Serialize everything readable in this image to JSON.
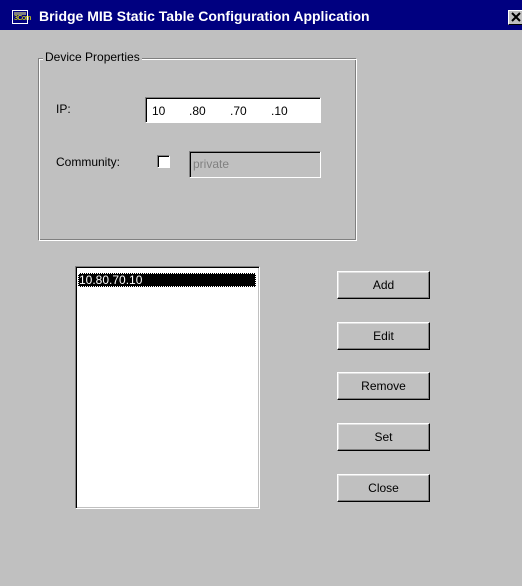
{
  "window": {
    "title": "Bridge MIB Static Table Configuration Application",
    "icon_label": "3Com",
    "icon": "app-icon",
    "close_icon": "close-icon"
  },
  "device_properties": {
    "group_label": "Device Properties",
    "ip_label": "IP:",
    "ip_octets": [
      "10",
      ".80",
      ".70",
      ".10"
    ],
    "community_label": "Community:",
    "community_checked": false,
    "community_value": "private"
  },
  "entries": {
    "items": [
      "10.80.70.10"
    ],
    "selected_index": 0
  },
  "buttons": {
    "add": "Add",
    "edit": "Edit",
    "remove": "Remove",
    "set": "Set",
    "close": "Close"
  },
  "colors": {
    "titlebar": "#000080",
    "face": "#c0c0c0",
    "selection": "#000000"
  }
}
